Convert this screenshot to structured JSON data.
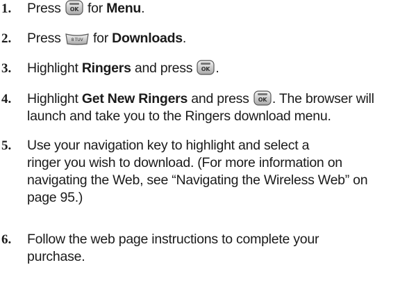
{
  "steps": [
    {
      "num": "1.",
      "before": "Press",
      "key": "menu-ok-key",
      "middle": "for",
      "bold": "Menu",
      "after": "."
    },
    {
      "num": "2.",
      "before": "Press",
      "key": "8-tuv-key",
      "key_text": "8 TUV",
      "middle": "for",
      "bold": "Downloads",
      "after": "."
    },
    {
      "num": "3.",
      "before": "Highlight",
      "bold": "Ringers",
      "middle": "and press",
      "key": "menu-ok-key",
      "after": "."
    },
    {
      "num": "4.",
      "before": "Highlight",
      "bold": "Get New Ringers",
      "middle": "and press",
      "key": "menu-ok-key",
      "after": ". The browser will",
      "line2": "launch and take you to the Ringers download menu."
    },
    {
      "num": "5.",
      "lines": [
        "Use your navigation key to highlight and select a",
        "ringer you wish to download. (For more information on",
        "navigating the Web, see “Navigating the Wireless Web” on",
        "page 95.)"
      ]
    },
    {
      "num": "6.",
      "lines": [
        "Follow the web page instructions to complete your",
        "purchase."
      ]
    }
  ],
  "key_labels": {
    "ok": "OK",
    "menu": "MENU"
  }
}
